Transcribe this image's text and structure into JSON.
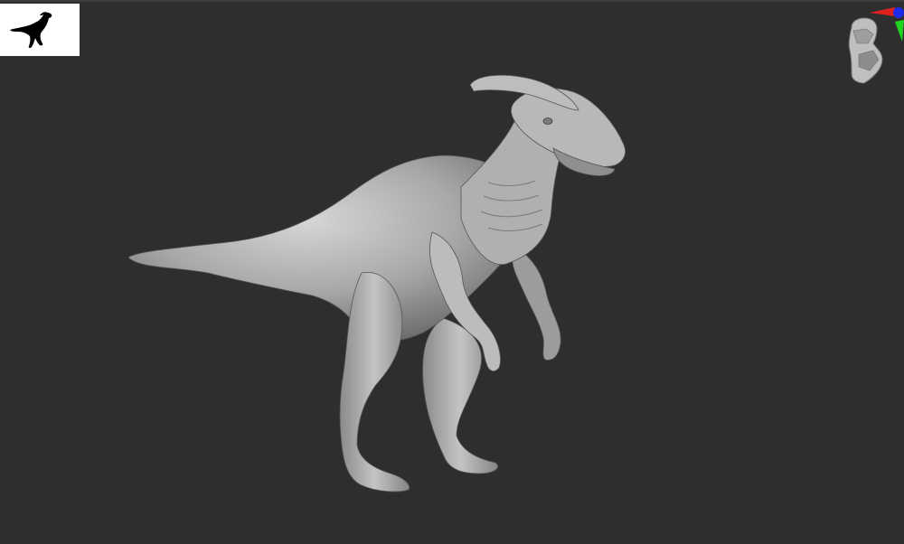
{
  "viewport": {
    "background_color": "#2e2e2e",
    "model_subject": "parasaurolophus-sculpt",
    "model_color": "#a9a9a9"
  },
  "thumbnail": {
    "icon": "dinosaur-silhouette-icon",
    "background_color": "#ffffff",
    "silhouette_color": "#000000"
  },
  "navigation_gizmo": {
    "icon": "head-navigation-icon",
    "axis_colors": {
      "x": "#e0201c",
      "y": "#1fd51f",
      "z": "#1c2ce8"
    }
  }
}
